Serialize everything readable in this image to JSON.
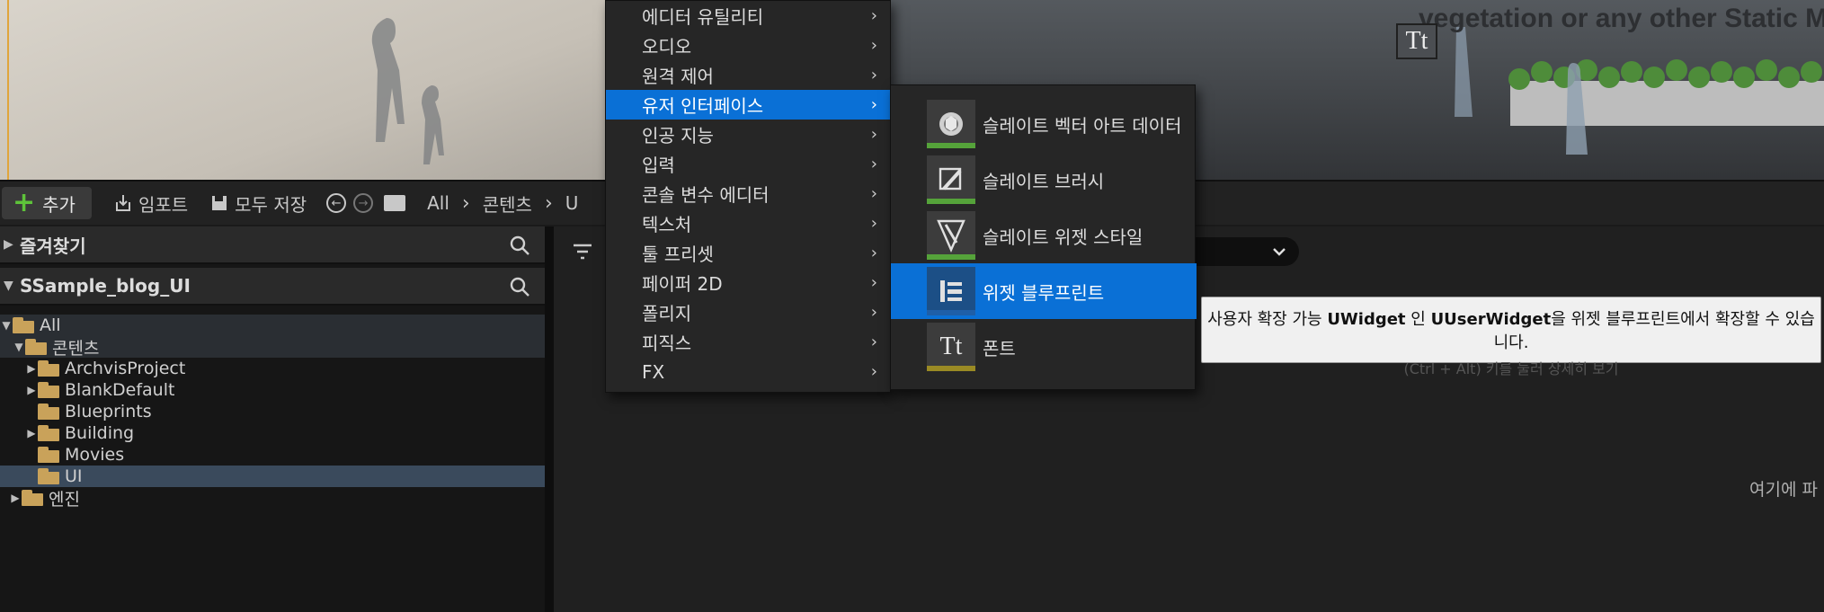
{
  "viewport": {
    "overlay_text": "vegetation or any other Static M",
    "font_badge": "Tt"
  },
  "toolbar": {
    "add_label": "추가",
    "import_label": "임포트",
    "save_all_label": "모두 저장",
    "breadcrumbs": [
      "All",
      "콘텐츠",
      "U"
    ]
  },
  "sources": {
    "favorites_title": "즐겨찾기",
    "project_title": "SSample_blog_UI",
    "tree": [
      {
        "label": "All",
        "depth": 0,
        "expanded": true
      },
      {
        "label": "콘텐츠",
        "depth": 1,
        "expanded": true
      },
      {
        "label": "ArchvisProject",
        "depth": 2,
        "has_children": true
      },
      {
        "label": "BlankDefault",
        "depth": 2,
        "has_children": true
      },
      {
        "label": "Blueprints",
        "depth": 2,
        "has_children": false
      },
      {
        "label": "Building",
        "depth": 2,
        "has_children": true
      },
      {
        "label": "Movies",
        "depth": 2,
        "has_children": false
      },
      {
        "label": "UI",
        "depth": 2,
        "has_children": false,
        "selected": true
      },
      {
        "label": "엔진",
        "depth": 0,
        "has_children": true
      }
    ]
  },
  "content": {
    "drop_hint": "여기에 파"
  },
  "menu": {
    "items": [
      {
        "label": "에디터 유틸리티"
      },
      {
        "label": "오디오"
      },
      {
        "label": "원격 제어"
      },
      {
        "label": "유저 인터페이스",
        "active": true
      },
      {
        "label": "인공 지능"
      },
      {
        "label": "입력"
      },
      {
        "label": "콘솔 변수 에디터"
      },
      {
        "label": "텍스처"
      },
      {
        "label": "툴 프리셋"
      },
      {
        "label": "페이퍼 2D"
      },
      {
        "label": "폴리지"
      },
      {
        "label": "피직스"
      },
      {
        "label": "FX"
      }
    ],
    "submenu": [
      {
        "label": "슬레이트 벡터 아트 데이터",
        "icon": "vector-art-icon",
        "bar_color": "#55a33a"
      },
      {
        "label": "슬레이트 브러시",
        "icon": "brush-icon",
        "bar_color": "#55a33a"
      },
      {
        "label": "슬레이트 위젯 스타일",
        "icon": "widget-style-icon",
        "bar_color": "#55a33a"
      },
      {
        "label": "위젯 블루프린트",
        "icon": "widget-blueprint-icon",
        "bar_color": "#1f5fa8",
        "active": true
      },
      {
        "label": "폰트",
        "icon": "font-icon",
        "bar_color": "#9a8a24",
        "glyph": "Tt"
      }
    ]
  },
  "tooltip": {
    "line1_pre": "사용자 확장 가능 ",
    "line1_b1": "UWidget",
    "line1_mid": " 인 ",
    "line1_b2": "UUserWidget",
    "line1_post": "을 위젯 블루프린트에서 확장할 수 있습니다.",
    "line2": "(Ctrl + Alt) 키를 눌러 상세히 보기"
  },
  "colors": {
    "accent": "#0a70d6",
    "add_plus": "#5ec33a",
    "folder": "#c9a25a"
  }
}
